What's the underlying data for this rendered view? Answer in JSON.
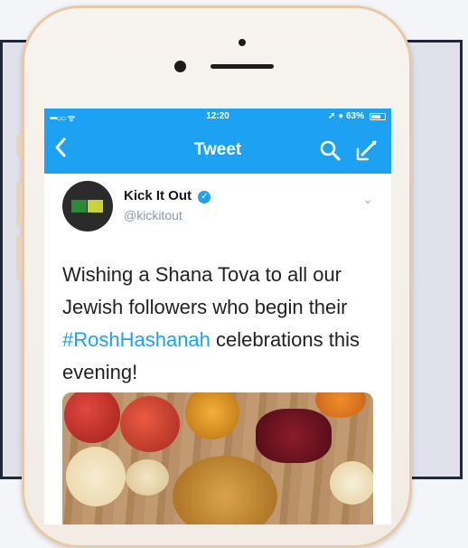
{
  "status_bar": {
    "carrier": "•••○○ ᯤ",
    "time": "12:20",
    "right": "➚ ● 63%"
  },
  "nav": {
    "back_icon": "chevron-left-icon",
    "title": "Tweet",
    "search_icon": "search-icon",
    "compose_icon": "compose-icon"
  },
  "tweet": {
    "author_name": "Kick It Out",
    "verified_mark": "✓",
    "handle": "@kickitout",
    "chevron": "⌄",
    "text_before": "Wishing a Shana Tova to all our Jewish followers who begin their ",
    "hashtag": "#RoshHashanah",
    "text_after": " celebrations this evening!"
  },
  "colors": {
    "twitter_blue": "#1da1f2",
    "panel_border": "#1f2838",
    "phone_frame": "#e7c9a7"
  }
}
